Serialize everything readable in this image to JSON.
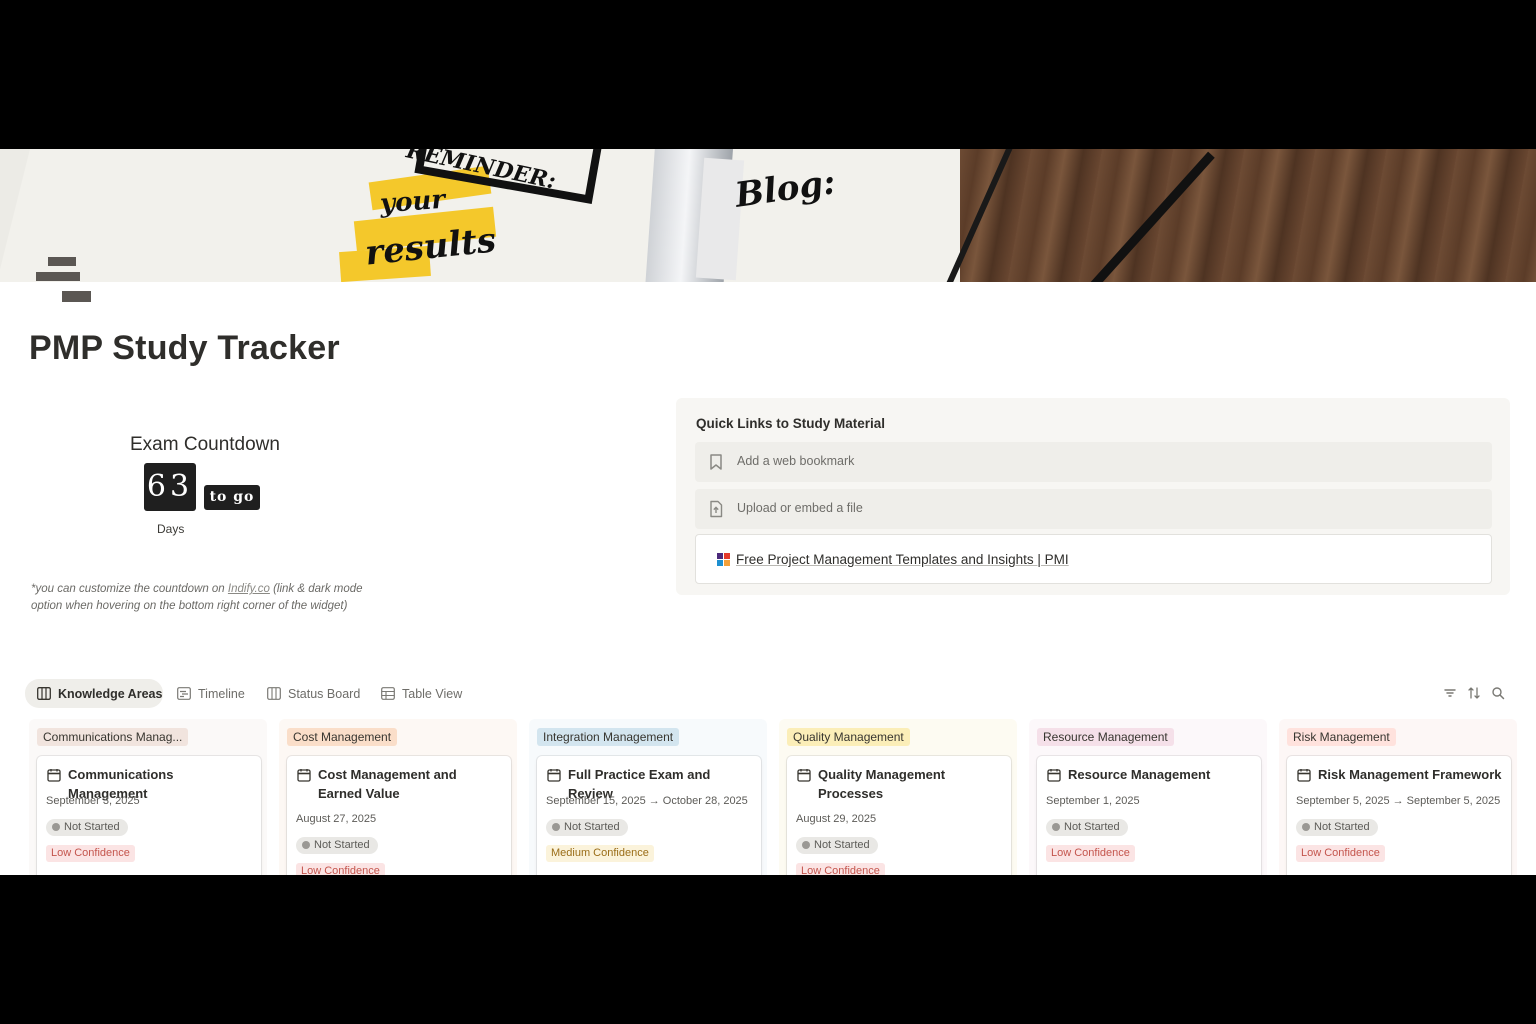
{
  "page": {
    "title": "PMP Study Tracker"
  },
  "countdown": {
    "title": "Exam Countdown",
    "digits": "63",
    "suffix": "to go",
    "unit": "Days",
    "note_prefix": "*you can customize the countdown on ",
    "note_link": "Indify.co",
    "note_suffix": " (link & dark mode option when hovering on the bottom right corner of the widget)"
  },
  "quick_links": {
    "title": "Quick Links to Study Material",
    "bookmark_placeholder": "Add a web bookmark",
    "file_placeholder": "Upload or embed a file",
    "bookmark": {
      "label": "Free Project Management Templates and Insights | PMI",
      "icon": "pmi-favicon"
    }
  },
  "views": {
    "tabs": [
      {
        "label": "Knowledge Areas",
        "icon": "board-icon",
        "active": true
      },
      {
        "label": "Timeline",
        "icon": "timeline-icon",
        "active": false
      },
      {
        "label": "Status Board",
        "icon": "board-icon",
        "active": false
      },
      {
        "label": "Table View",
        "icon": "table-icon",
        "active": false
      }
    ],
    "tools": [
      "filter-icon",
      "sort-icon",
      "search-icon"
    ]
  },
  "board": {
    "columns": [
      {
        "tag": "Communications Manag...",
        "tag_color": "#f1e4de",
        "col_bg": "#fbf9f8",
        "card": {
          "name": "Communications Management",
          "date": "September 3, 2025",
          "status": "Not Started",
          "confidence": "Low Confidence",
          "conf_bg": "#fbe4e4",
          "conf_fg": "#c4554d"
        }
      },
      {
        "tag": "Cost Management",
        "tag_color": "#fadec9",
        "col_bg": "#fdf8f4",
        "card": {
          "name": "Cost Management and Earned Value",
          "date": "August 27, 2025",
          "status": "Not Started",
          "confidence": "Low Confidence",
          "conf_bg": "#fbe4e4",
          "conf_fg": "#c4554d"
        }
      },
      {
        "tag": "Integration Management",
        "tag_color": "#d3e5ef",
        "col_bg": "#f7fafc",
        "card": {
          "name": "Full Practice Exam and Review",
          "date": "September 15, 2025 → October 28, 2025",
          "status": "Not Started",
          "confidence": "Medium Confidence",
          "conf_bg": "#fbf3db",
          "conf_fg": "#9a6d18"
        }
      },
      {
        "tag": "Quality Management",
        "tag_color": "#fbeeb8",
        "col_bg": "#fdfbf2",
        "card": {
          "name": "Quality Management Processes",
          "date": "August 29, 2025",
          "status": "Not Started",
          "confidence": "Low Confidence",
          "conf_bg": "#fbe4e4",
          "conf_fg": "#c4554d"
        }
      },
      {
        "tag": "Resource Management",
        "tag_color": "#f5e0e9",
        "col_bg": "#fcf8fa",
        "card": {
          "name": "Resource Management",
          "date": "September 1, 2025",
          "status": "Not Started",
          "confidence": "Low Confidence",
          "conf_bg": "#fbe4e4",
          "conf_fg": "#c4554d"
        }
      },
      {
        "tag": "Risk Management",
        "tag_color": "#ffe2dd",
        "col_bg": "#fdf7f6",
        "card": {
          "name": "Risk Management Framework",
          "date": "September 5, 2025 → September 5, 2025",
          "status": "Not Started",
          "confidence": "Low Confidence",
          "conf_bg": "#fbe4e4",
          "conf_fg": "#c4554d"
        }
      }
    ]
  }
}
